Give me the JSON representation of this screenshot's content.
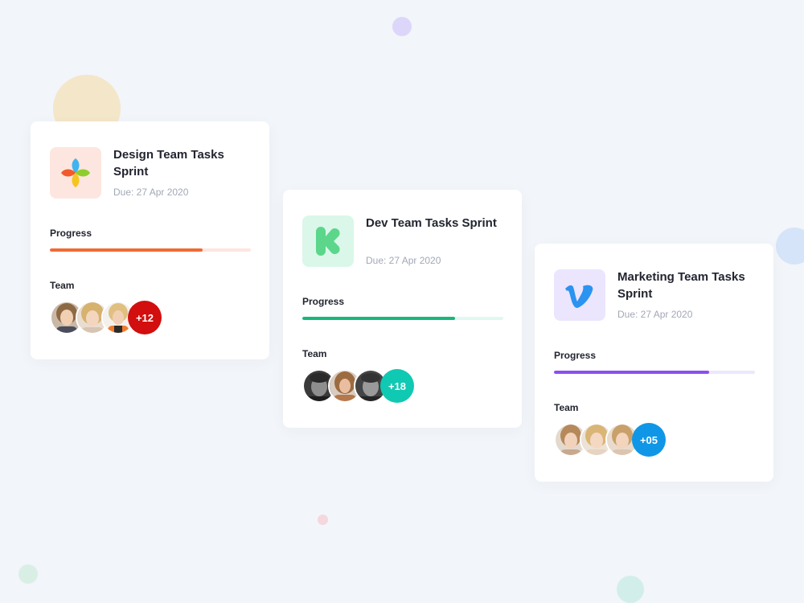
{
  "cards": [
    {
      "title": "Design Team Tasks Sprint",
      "due": "Due: 27 Apr 2020",
      "logo_icon": "four-petal-flower-icon",
      "logo_bg": "#fde6df",
      "progress_label": "Progress",
      "progress_percent": 76,
      "progress_color": "#f06b34",
      "progress_track": "#fde5df",
      "team_label": "Team",
      "team_extra": "+12",
      "badge_color": "#d20e0e",
      "avatars": [
        "avatar-woman-1",
        "avatar-woman-2",
        "avatar-woman-3"
      ]
    },
    {
      "title": "Dev Team Tasks Sprint",
      "due": "Due: 27 Apr 2020",
      "logo_icon": "kickstarter-k-icon",
      "logo_bg": "#daf7ea",
      "progress_label": "Progress",
      "progress_percent": 76,
      "progress_color": "#16b87b",
      "progress_track": "#e0f8f1",
      "team_label": "Team",
      "team_extra": "+18",
      "badge_color": "#10c9b3",
      "avatars": [
        "avatar-man-1",
        "avatar-woman-4",
        "avatar-man-2"
      ]
    },
    {
      "title": "Marketing Team Tasks Sprint",
      "due": "Due: 27 Apr 2020",
      "logo_icon": "vimeo-v-icon",
      "logo_bg": "#ebe5fd",
      "progress_label": "Progress",
      "progress_percent": 77,
      "progress_color": "#8b4ff0",
      "progress_track": "#ece7fd",
      "team_label": "Team",
      "team_extra": "+05",
      "badge_color": "#1096e6",
      "avatars": [
        "avatar-woman-5",
        "avatar-woman-6",
        "avatar-woman-7"
      ]
    }
  ]
}
